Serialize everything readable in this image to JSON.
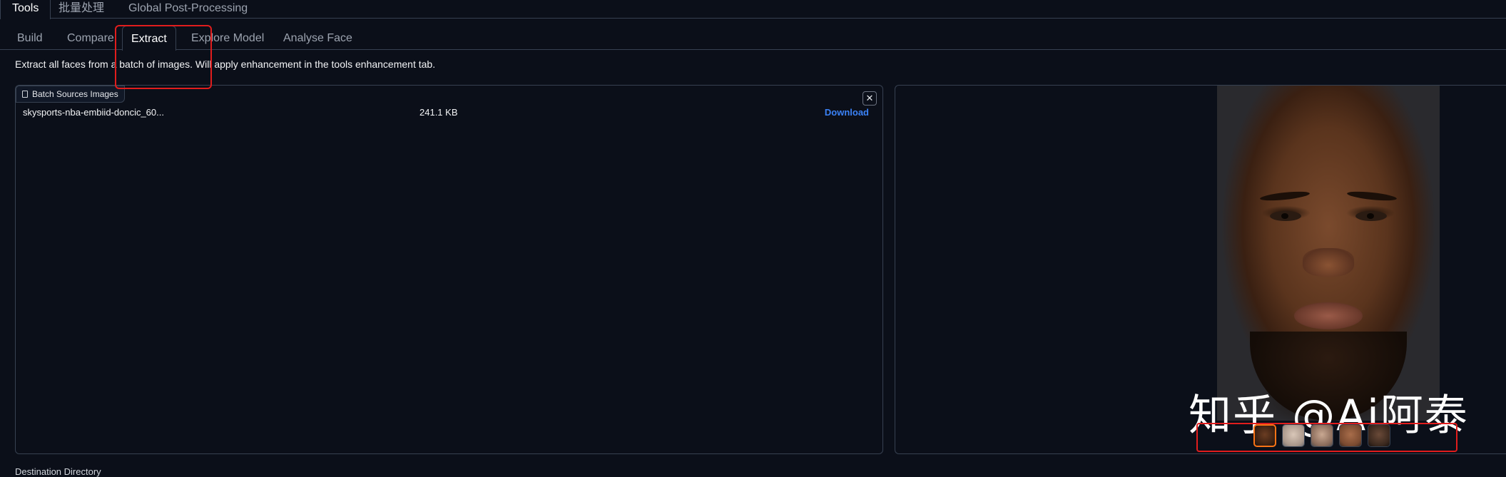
{
  "top_tabs": [
    {
      "label": "Tools",
      "active": true
    },
    {
      "label": "批量处理",
      "active": false
    },
    {
      "label": "Global Post-Processing",
      "active": false
    }
  ],
  "sub_tabs": [
    {
      "label": "Build",
      "active": false
    },
    {
      "label": "Compare",
      "active": false
    },
    {
      "label": "Extract",
      "active": true
    },
    {
      "label": "Explore Model",
      "active": false
    },
    {
      "label": "Analyse Face",
      "active": false
    }
  ],
  "description": "Extract all faces from a batch of images. Will apply enhancement in the tools enhancement tab.",
  "file_panel": {
    "label": "Batch Sources Images",
    "close_glyph": "✕",
    "files": [
      {
        "name": "skysports-nba-embiid-doncic_60...",
        "size": "241.1 KB",
        "action": "Download"
      }
    ]
  },
  "gallery": {
    "thumbnail_count": 5,
    "selected_index": 0
  },
  "watermark": "知乎 @Ai阿泰",
  "destination_label": "Destination Directory",
  "colors": {
    "background": "#0b0f19",
    "border": "#374151",
    "link": "#3b82f6",
    "selected": "#f97316",
    "highlight": "#e11d1d"
  }
}
